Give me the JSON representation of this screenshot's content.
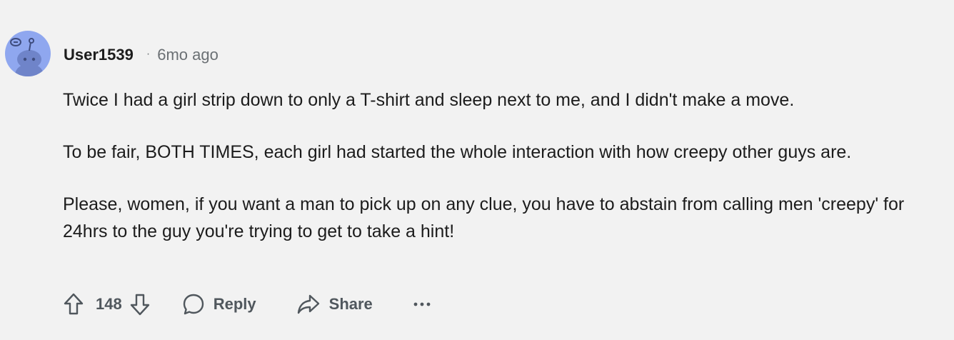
{
  "comment": {
    "username": "User1539",
    "separator": "·",
    "timestamp": "6mo ago",
    "avatar_icon": "snoo-avatar-icon",
    "paragraphs": [
      "Twice I had a girl strip down to only a T-shirt and sleep next to me, and I didn't make a move.",
      "To be fair, BOTH TIMES, each girl had started the whole interaction with how creepy other guys are.",
      "Please, women, if you want a man to pick up on any clue, you have to abstain from calling men 'creepy' for 24hrs to the guy you're trying to get to take a hint!"
    ]
  },
  "actions": {
    "upvote_icon": "upvote-arrow-icon",
    "vote_count": "148",
    "downvote_icon": "downvote-arrow-icon",
    "reply_icon": "speech-bubble-icon",
    "reply_label": "Reply",
    "share_icon": "share-arrow-icon",
    "share_label": "Share",
    "more_icon": "ellipsis-icon",
    "more_label": "···"
  },
  "colors": {
    "background": "#f2f2f2",
    "avatar_bg": "#8fa7ef",
    "text_primary": "#1c1c1c",
    "text_secondary": "#6b7074",
    "action_text": "#50575d"
  }
}
